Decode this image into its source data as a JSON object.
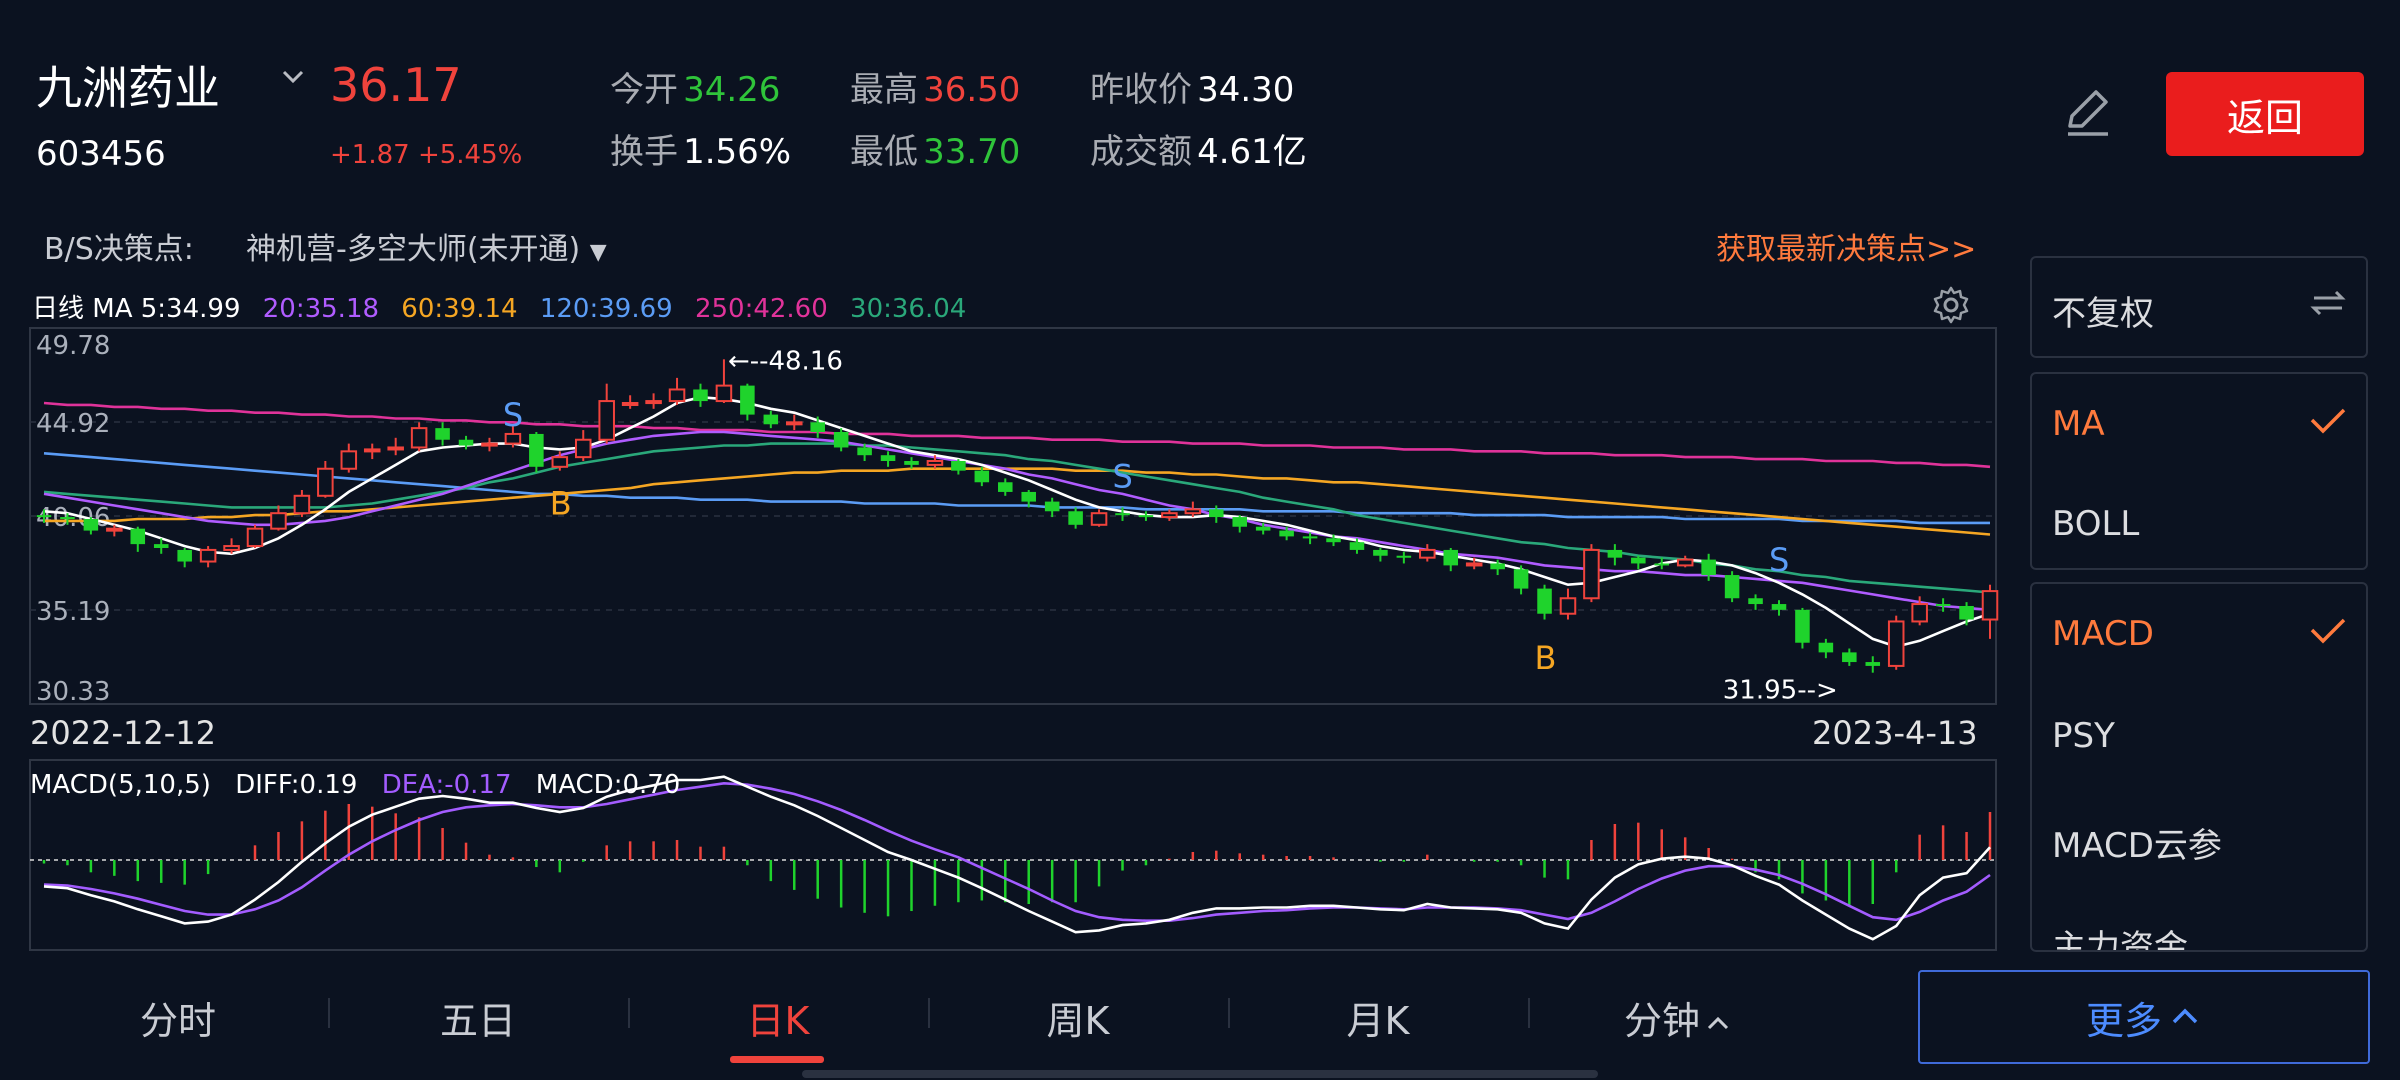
{
  "header": {
    "stock_name": "九洲药业",
    "stock_code": "603456",
    "price": "36.17",
    "change": "+1.87 +5.45%",
    "quotes": [
      {
        "label": "今开",
        "value": "34.26",
        "color": "green"
      },
      {
        "label": "最高",
        "value": "36.50",
        "color": "red"
      },
      {
        "label": "昨收价",
        "value": "34.30",
        "color": "white"
      },
      {
        "label": "换手",
        "value": "1.56%",
        "color": "white"
      },
      {
        "label": "最低",
        "value": "33.70",
        "color": "green"
      },
      {
        "label": "成交额",
        "value": "4.61亿",
        "color": "white"
      }
    ],
    "back_label": "返回"
  },
  "decision": {
    "label": "B/S决策点:",
    "selector": "神机营-多空大师(未开通)",
    "fetch_link": "获取最新决策点>>"
  },
  "ma_legend": [
    {
      "text": "日线 MA 5:34.99",
      "color": "#ffffff"
    },
    {
      "text": "20:35.18",
      "color": "#b05cff"
    },
    {
      "text": "60:39.14",
      "color": "#f5a623"
    },
    {
      "text": "120:39.69",
      "color": "#5b9cf5"
    },
    {
      "text": "250:42.60",
      "color": "#e0339a"
    },
    {
      "text": "30:36.04",
      "color": "#2aa87a"
    }
  ],
  "macd_legend": [
    {
      "text": "MACD(5,10,5)",
      "color": "#ffffff"
    },
    {
      "text": "DIFF:0.19",
      "color": "#ffffff"
    },
    {
      "text": "DEA:-0.17",
      "color": "#a35cff"
    },
    {
      "text": "MACD:0.70",
      "color": "#ffffff"
    }
  ],
  "side_panel": {
    "fq_label": "不复权",
    "main_items": [
      {
        "label": "MA",
        "checked": true
      },
      {
        "label": "BOLL",
        "checked": false
      }
    ],
    "sub_items": [
      {
        "label": "MACD",
        "checked": true
      },
      {
        "label": "PSY",
        "checked": false
      },
      {
        "label": "MACD云参",
        "checked": false
      },
      {
        "label": "主力资金",
        "checked": false
      }
    ]
  },
  "tabs": [
    {
      "label": "分时",
      "active": false
    },
    {
      "label": "五日",
      "active": false
    },
    {
      "label": "日K",
      "active": true
    },
    {
      "label": "周K",
      "active": false
    },
    {
      "label": "月K",
      "active": false
    },
    {
      "label": "分钟",
      "active": false
    }
  ],
  "more_label": "更多",
  "icons": [
    "chevron-down-icon",
    "edit-pencil-icon",
    "settings-gear-icon",
    "swap-icon",
    "check-icon",
    "chevron-up-icon"
  ],
  "chart_data": {
    "type": "candlestick",
    "start_date": "2022-12-12",
    "end_date": "2023-4-13",
    "y_ticks": [
      "49.78",
      "44.92",
      "40.06",
      "35.19",
      "30.33"
    ],
    "ylim": [
      30.33,
      49.78
    ],
    "max_annotation": "←--48.16",
    "min_annotation": "31.95-->",
    "max_price": 48.16,
    "min_price": 31.95,
    "candles": [
      [
        40.1,
        40.0,
        40.4,
        39.7
      ],
      [
        40.0,
        39.9,
        40.2,
        39.6
      ],
      [
        39.9,
        39.3,
        40.0,
        39.1
      ],
      [
        39.3,
        39.4,
        39.6,
        39.0
      ],
      [
        39.4,
        38.6,
        39.5,
        38.2
      ],
      [
        38.6,
        38.4,
        38.9,
        38.1
      ],
      [
        38.3,
        37.7,
        38.4,
        37.4
      ],
      [
        37.7,
        38.3,
        38.5,
        37.4
      ],
      [
        38.3,
        38.5,
        38.9,
        38.1
      ],
      [
        38.5,
        39.4,
        39.6,
        38.4
      ],
      [
        39.4,
        40.2,
        40.6,
        39.3
      ],
      [
        40.2,
        41.1,
        41.4,
        40.0
      ],
      [
        41.1,
        42.5,
        42.9,
        41.0
      ],
      [
        42.5,
        43.4,
        43.8,
        42.3
      ],
      [
        43.4,
        43.5,
        43.8,
        43.0
      ],
      [
        43.5,
        43.6,
        44.1,
        43.2
      ],
      [
        43.6,
        44.6,
        44.9,
        43.4
      ],
      [
        44.6,
        44.0,
        44.9,
        43.7
      ],
      [
        44.0,
        43.7,
        44.2,
        43.5
      ],
      [
        43.7,
        43.8,
        44.1,
        43.4
      ],
      [
        43.8,
        44.3,
        44.7,
        43.6
      ],
      [
        44.3,
        42.6,
        44.4,
        42.3
      ],
      [
        42.6,
        43.1,
        43.4,
        42.4
      ],
      [
        43.1,
        44.0,
        44.5,
        42.9
      ],
      [
        44.0,
        46.0,
        46.9,
        43.8
      ],
      [
        45.9,
        45.9,
        46.3,
        45.6
      ],
      [
        45.9,
        46.0,
        46.4,
        45.6
      ],
      [
        46.0,
        46.6,
        47.2,
        45.8
      ],
      [
        46.6,
        46.0,
        46.9,
        45.7
      ],
      [
        46.0,
        46.8,
        48.16,
        45.9
      ],
      [
        46.8,
        45.3,
        46.9,
        45.0
      ],
      [
        45.3,
        44.8,
        45.5,
        44.6
      ],
      [
        44.8,
        44.9,
        45.3,
        44.5
      ],
      [
        44.9,
        44.4,
        45.2,
        44.1
      ],
      [
        44.4,
        43.6,
        44.6,
        43.4
      ],
      [
        43.6,
        43.2,
        43.8,
        42.9
      ],
      [
        43.2,
        42.9,
        43.4,
        42.6
      ],
      [
        42.9,
        42.7,
        43.1,
        42.5
      ],
      [
        42.7,
        42.9,
        43.2,
        42.5
      ],
      [
        42.9,
        42.4,
        43.0,
        42.2
      ],
      [
        42.4,
        41.8,
        42.6,
        41.6
      ],
      [
        41.8,
        41.3,
        42.0,
        41.1
      ],
      [
        41.3,
        40.8,
        41.4,
        40.5
      ],
      [
        40.8,
        40.3,
        41.0,
        40.0
      ],
      [
        40.3,
        39.6,
        40.5,
        39.4
      ],
      [
        39.6,
        40.2,
        40.4,
        39.5
      ],
      [
        40.2,
        40.1,
        40.5,
        39.8
      ],
      [
        40.1,
        40.0,
        40.3,
        39.8
      ],
      [
        40.0,
        40.2,
        40.4,
        39.8
      ],
      [
        40.2,
        40.4,
        40.8,
        40.0
      ],
      [
        40.4,
        40.0,
        40.6,
        39.7
      ],
      [
        40.0,
        39.5,
        40.1,
        39.2
      ],
      [
        39.5,
        39.3,
        39.7,
        39.1
      ],
      [
        39.3,
        39.0,
        39.5,
        38.8
      ],
      [
        39.0,
        38.9,
        39.2,
        38.6
      ],
      [
        38.9,
        38.7,
        39.1,
        38.5
      ],
      [
        38.7,
        38.3,
        38.9,
        38.1
      ],
      [
        38.3,
        38.0,
        38.4,
        37.7
      ],
      [
        38.0,
        37.9,
        38.2,
        37.6
      ],
      [
        37.9,
        38.3,
        38.6,
        37.7
      ],
      [
        38.3,
        37.5,
        38.4,
        37.2
      ],
      [
        37.5,
        37.6,
        37.9,
        37.3
      ],
      [
        37.6,
        37.3,
        37.8,
        37.0
      ],
      [
        37.3,
        36.3,
        37.5,
        36.0
      ],
      [
        36.3,
        35.0,
        36.5,
        34.7
      ],
      [
        35.0,
        35.8,
        36.3,
        34.7
      ],
      [
        35.8,
        38.3,
        38.6,
        35.6
      ],
      [
        38.3,
        37.9,
        38.6,
        37.5
      ],
      [
        37.9,
        37.6,
        38.0,
        37.3
      ],
      [
        37.6,
        37.5,
        37.9,
        37.3
      ],
      [
        37.5,
        37.8,
        38.0,
        37.4
      ],
      [
        37.8,
        37.0,
        38.1,
        36.7
      ],
      [
        37.0,
        35.8,
        37.2,
        35.6
      ],
      [
        35.8,
        35.5,
        36.0,
        35.2
      ],
      [
        35.5,
        35.2,
        35.7,
        34.9
      ],
      [
        35.2,
        33.5,
        35.3,
        33.2
      ],
      [
        33.5,
        33.0,
        33.7,
        32.7
      ],
      [
        33.0,
        32.5,
        33.2,
        32.3
      ],
      [
        32.5,
        32.3,
        32.8,
        31.95
      ],
      [
        32.3,
        34.6,
        34.9,
        32.1
      ],
      [
        34.6,
        35.5,
        35.9,
        34.4
      ],
      [
        35.5,
        35.4,
        35.8,
        35.1
      ],
      [
        35.4,
        34.7,
        35.6,
        34.4
      ],
      [
        34.7,
        36.17,
        36.5,
        33.7
      ]
    ],
    "ma_series": {
      "ma5": [
        40.3,
        40.2,
        39.9,
        39.6,
        39.3,
        38.9,
        38.5,
        38.2,
        38.1,
        38.4,
        38.9,
        39.6,
        40.4,
        41.3,
        42.0,
        42.7,
        43.4,
        43.6,
        43.7,
        43.8,
        43.8,
        43.6,
        43.5,
        43.6,
        44.0,
        44.6,
        45.2,
        45.9,
        46.2,
        46.1,
        45.9,
        45.6,
        45.4,
        45.0,
        44.6,
        44.2,
        43.8,
        43.4,
        43.2,
        43.0,
        42.7,
        42.3,
        41.9,
        41.4,
        40.9,
        40.5,
        40.3,
        40.1,
        40.0,
        40.0,
        40.1,
        40.0,
        39.8,
        39.6,
        39.3,
        39.0,
        38.8,
        38.5,
        38.3,
        38.2,
        38.0,
        37.8,
        37.6,
        37.3,
        36.9,
        36.5,
        36.6,
        36.9,
        37.2,
        37.6,
        37.8,
        37.7,
        37.5,
        37.1,
        36.6,
        36.0,
        35.3,
        34.5,
        33.7,
        33.3,
        33.6,
        34.1,
        34.6,
        35.0
      ],
      "ma20": [
        41.2,
        41.0,
        40.8,
        40.6,
        40.4,
        40.2,
        40.0,
        39.8,
        39.7,
        39.6,
        39.6,
        39.7,
        39.8,
        40.0,
        40.3,
        40.6,
        40.9,
        41.2,
        41.6,
        42.0,
        42.4,
        42.8,
        43.2,
        43.5,
        43.8,
        44.0,
        44.2,
        44.3,
        44.4,
        44.4,
        44.3,
        44.2,
        44.1,
        44.0,
        43.9,
        43.7,
        43.5,
        43.3,
        43.1,
        42.9,
        42.7,
        42.5,
        42.2,
        42.0,
        41.7,
        41.4,
        41.2,
        40.9,
        40.6,
        40.4,
        40.1,
        39.9,
        39.6,
        39.4,
        39.2,
        39.0,
        38.9,
        38.7,
        38.5,
        38.3,
        38.1,
        38.0,
        37.9,
        37.7,
        37.5,
        37.4,
        37.3,
        37.2,
        37.2,
        37.1,
        37.0,
        37.0,
        36.9,
        36.8,
        36.7,
        36.6,
        36.4,
        36.2,
        36.0,
        35.8,
        35.6,
        35.4,
        35.3,
        35.2
      ],
      "ma30": [
        41.3,
        41.2,
        41.1,
        41.0,
        40.9,
        40.8,
        40.7,
        40.6,
        40.5,
        40.5,
        40.5,
        40.5,
        40.5,
        40.6,
        40.7,
        40.9,
        41.1,
        41.3,
        41.5,
        41.8,
        42.0,
        42.3,
        42.6,
        42.8,
        43.0,
        43.2,
        43.4,
        43.5,
        43.6,
        43.7,
        43.7,
        43.8,
        43.8,
        43.8,
        43.8,
        43.7,
        43.7,
        43.6,
        43.5,
        43.4,
        43.3,
        43.2,
        43.0,
        42.9,
        42.7,
        42.5,
        42.3,
        42.1,
        41.9,
        41.7,
        41.5,
        41.3,
        41.0,
        40.8,
        40.6,
        40.4,
        40.1,
        39.9,
        39.7,
        39.5,
        39.3,
        39.1,
        38.9,
        38.7,
        38.6,
        38.4,
        38.3,
        38.2,
        38.0,
        37.9,
        37.8,
        37.6,
        37.5,
        37.3,
        37.2,
        37.0,
        36.9,
        36.7,
        36.6,
        36.5,
        36.4,
        36.3,
        36.2,
        36.1
      ],
      "ma60": [
        39.8,
        39.8,
        39.8,
        39.8,
        39.9,
        39.9,
        39.9,
        40.0,
        40.0,
        40.1,
        40.1,
        40.2,
        40.3,
        40.3,
        40.4,
        40.5,
        40.6,
        40.7,
        40.8,
        40.9,
        41.0,
        41.1,
        41.2,
        41.3,
        41.4,
        41.5,
        41.7,
        41.8,
        41.9,
        42.0,
        42.1,
        42.2,
        42.3,
        42.3,
        42.4,
        42.4,
        42.4,
        42.5,
        42.5,
        42.5,
        42.5,
        42.5,
        42.5,
        42.5,
        42.4,
        42.4,
        42.4,
        42.3,
        42.3,
        42.2,
        42.2,
        42.1,
        42.0,
        42.0,
        41.9,
        41.8,
        41.8,
        41.7,
        41.6,
        41.5,
        41.4,
        41.3,
        41.2,
        41.1,
        41.0,
        40.9,
        40.8,
        40.7,
        40.6,
        40.5,
        40.4,
        40.3,
        40.2,
        40.1,
        40.0,
        39.9,
        39.8,
        39.7,
        39.6,
        39.5,
        39.4,
        39.3,
        39.2,
        39.1
      ],
      "ma120": [
        43.3,
        43.2,
        43.1,
        43.0,
        42.9,
        42.8,
        42.7,
        42.6,
        42.5,
        42.4,
        42.3,
        42.2,
        42.1,
        42.0,
        41.9,
        41.8,
        41.7,
        41.6,
        41.5,
        41.4,
        41.3,
        41.2,
        41.2,
        41.1,
        41.1,
        41.0,
        41.0,
        41.0,
        40.9,
        40.9,
        40.9,
        40.8,
        40.8,
        40.8,
        40.8,
        40.7,
        40.7,
        40.7,
        40.7,
        40.6,
        40.6,
        40.6,
        40.6,
        40.5,
        40.5,
        40.5,
        40.5,
        40.4,
        40.4,
        40.4,
        40.4,
        40.4,
        40.3,
        40.3,
        40.3,
        40.3,
        40.2,
        40.2,
        40.2,
        40.2,
        40.2,
        40.1,
        40.1,
        40.1,
        40.1,
        40.0,
        40.0,
        40.0,
        40.0,
        40.0,
        39.9,
        39.9,
        39.9,
        39.9,
        39.9,
        39.8,
        39.8,
        39.8,
        39.8,
        39.8,
        39.7,
        39.7,
        39.7,
        39.7
      ],
      "ma250": [
        45.9,
        45.8,
        45.8,
        45.7,
        45.7,
        45.6,
        45.6,
        45.5,
        45.5,
        45.4,
        45.4,
        45.3,
        45.3,
        45.2,
        45.2,
        45.1,
        45.1,
        45.0,
        45.0,
        44.9,
        44.9,
        44.8,
        44.8,
        44.7,
        44.7,
        44.7,
        44.6,
        44.6,
        44.5,
        44.5,
        44.5,
        44.4,
        44.4,
        44.4,
        44.3,
        44.3,
        44.3,
        44.2,
        44.2,
        44.2,
        44.1,
        44.1,
        44.1,
        44.0,
        44.0,
        44.0,
        43.9,
        43.9,
        43.9,
        43.8,
        43.8,
        43.8,
        43.7,
        43.7,
        43.7,
        43.6,
        43.6,
        43.6,
        43.5,
        43.5,
        43.5,
        43.4,
        43.4,
        43.4,
        43.3,
        43.3,
        43.3,
        43.2,
        43.2,
        43.2,
        43.1,
        43.1,
        43.1,
        43.0,
        43.0,
        43.0,
        42.9,
        42.9,
        42.9,
        42.8,
        42.8,
        42.7,
        42.7,
        42.6
      ]
    },
    "bs_markers": [
      {
        "label": "S",
        "index": 20,
        "price": 44.2
      },
      {
        "label": "B",
        "index": 22,
        "price": 42.0
      },
      {
        "label": "S",
        "index": 46,
        "price": 41.0
      },
      {
        "label": "B",
        "index": 64,
        "price": 34.0
      },
      {
        "label": "S",
        "index": 74,
        "price": 36.7
      }
    ],
    "macd": {
      "diff": [
        -0.3,
        -0.32,
        -0.4,
        -0.47,
        -0.56,
        -0.64,
        -0.72,
        -0.7,
        -0.62,
        -0.45,
        -0.25,
        -0.02,
        0.25,
        0.5,
        0.68,
        0.8,
        0.92,
        0.96,
        0.92,
        0.86,
        0.86,
        0.78,
        0.72,
        0.78,
        0.95,
        1.05,
        1.12,
        1.2,
        1.2,
        1.25,
        1.1,
        0.95,
        0.82,
        0.66,
        0.48,
        0.3,
        0.12,
        0.0,
        -0.1,
        -0.2,
        -0.32,
        -0.45,
        -0.58,
        -0.7,
        -0.82,
        -0.8,
        -0.74,
        -0.72,
        -0.68,
        -0.6,
        -0.55,
        -0.55,
        -0.54,
        -0.54,
        -0.52,
        -0.52,
        -0.54,
        -0.56,
        -0.57,
        -0.5,
        -0.54,
        -0.55,
        -0.56,
        -0.6,
        -0.72,
        -0.78,
        -0.45,
        -0.2,
        -0.05,
        0.02,
        0.05,
        0.02,
        -0.06,
        -0.18,
        -0.28,
        -0.46,
        -0.62,
        -0.78,
        -0.9,
        -0.75,
        -0.4,
        -0.2,
        -0.15,
        0.19
      ],
      "dea": [
        -0.28,
        -0.29,
        -0.33,
        -0.38,
        -0.44,
        -0.51,
        -0.58,
        -0.62,
        -0.62,
        -0.56,
        -0.46,
        -0.31,
        -0.12,
        0.08,
        0.28,
        0.45,
        0.6,
        0.72,
        0.79,
        0.82,
        0.84,
        0.82,
        0.79,
        0.79,
        0.84,
        0.91,
        0.98,
        1.05,
        1.1,
        1.15,
        1.13,
        1.07,
        0.99,
        0.88,
        0.75,
        0.6,
        0.44,
        0.29,
        0.16,
        0.04,
        -0.09,
        -0.21,
        -0.33,
        -0.46,
        -0.58,
        -0.65,
        -0.68,
        -0.69,
        -0.69,
        -0.66,
        -0.62,
        -0.6,
        -0.58,
        -0.57,
        -0.55,
        -0.54,
        -0.54,
        -0.55,
        -0.56,
        -0.54,
        -0.54,
        -0.54,
        -0.55,
        -0.57,
        -0.62,
        -0.67,
        -0.6,
        -0.47,
        -0.33,
        -0.21,
        -0.12,
        -0.07,
        -0.07,
        -0.11,
        -0.17,
        -0.27,
        -0.39,
        -0.52,
        -0.65,
        -0.68,
        -0.59,
        -0.46,
        -0.36,
        -0.17
      ]
    }
  }
}
